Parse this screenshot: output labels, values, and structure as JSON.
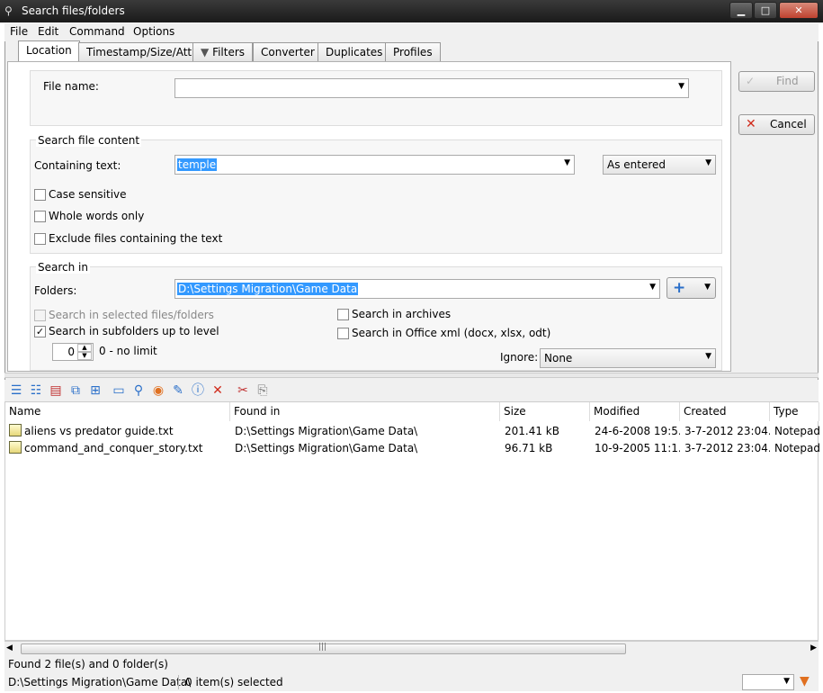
{
  "window": {
    "title": "Search files/folders",
    "minimize": "▁",
    "maximize": "□",
    "close": "✕"
  },
  "menu": [
    "File",
    "Edit",
    "Command",
    "Options"
  ],
  "tabs": [
    "Location",
    "Timestamp/Size/Attr",
    "Filters",
    "Converter",
    "Duplicates",
    "Profiles"
  ],
  "location": {
    "file_name_label": "File name:",
    "file_name_value": "",
    "content_group": "Search file content",
    "containing_label": "Containing text:",
    "containing_value": "temple",
    "match_mode": "As entered",
    "case_sensitive": "Case sensitive",
    "whole_words": "Whole words only",
    "exclude_files": "Exclude files containing the text",
    "search_in_group": "Search in",
    "folders_label": "Folders:",
    "folders_value": "D:\\Settings Migration\\Game Data",
    "search_selected": "Search in selected files/folders",
    "search_subfolders": "Search in subfolders up to level",
    "level_value": "0",
    "level_hint": "0 - no limit",
    "search_archives": "Search in archives",
    "search_office": "Search in Office xml (docx, xlsx, odt)",
    "ignore_label": "Ignore:",
    "ignore_value": "None"
  },
  "buttons": {
    "find": "Find",
    "cancel": "Cancel"
  },
  "columns": [
    "Name",
    "Found in",
    "Size",
    "Modified",
    "Created",
    "Type"
  ],
  "rows": [
    [
      "aliens vs predator guide.txt",
      "D:\\Settings Migration\\Game Data\\",
      "201.41 kB",
      "24-6-2008 19:5...",
      "3-7-2012 23:04...",
      "Notepad+"
    ],
    [
      "command_and_conquer_story.txt",
      "D:\\Settings Migration\\Game Data\\",
      "96.71 kB",
      "10-9-2005 11:1...",
      "3-7-2012 23:04...",
      "Notepad+"
    ]
  ],
  "status": {
    "found": "Found 2 file(s) and 0 folder(s)",
    "path": "D:\\Settings Migration\\Game Data\\",
    "selected": "0 item(s) selected"
  }
}
